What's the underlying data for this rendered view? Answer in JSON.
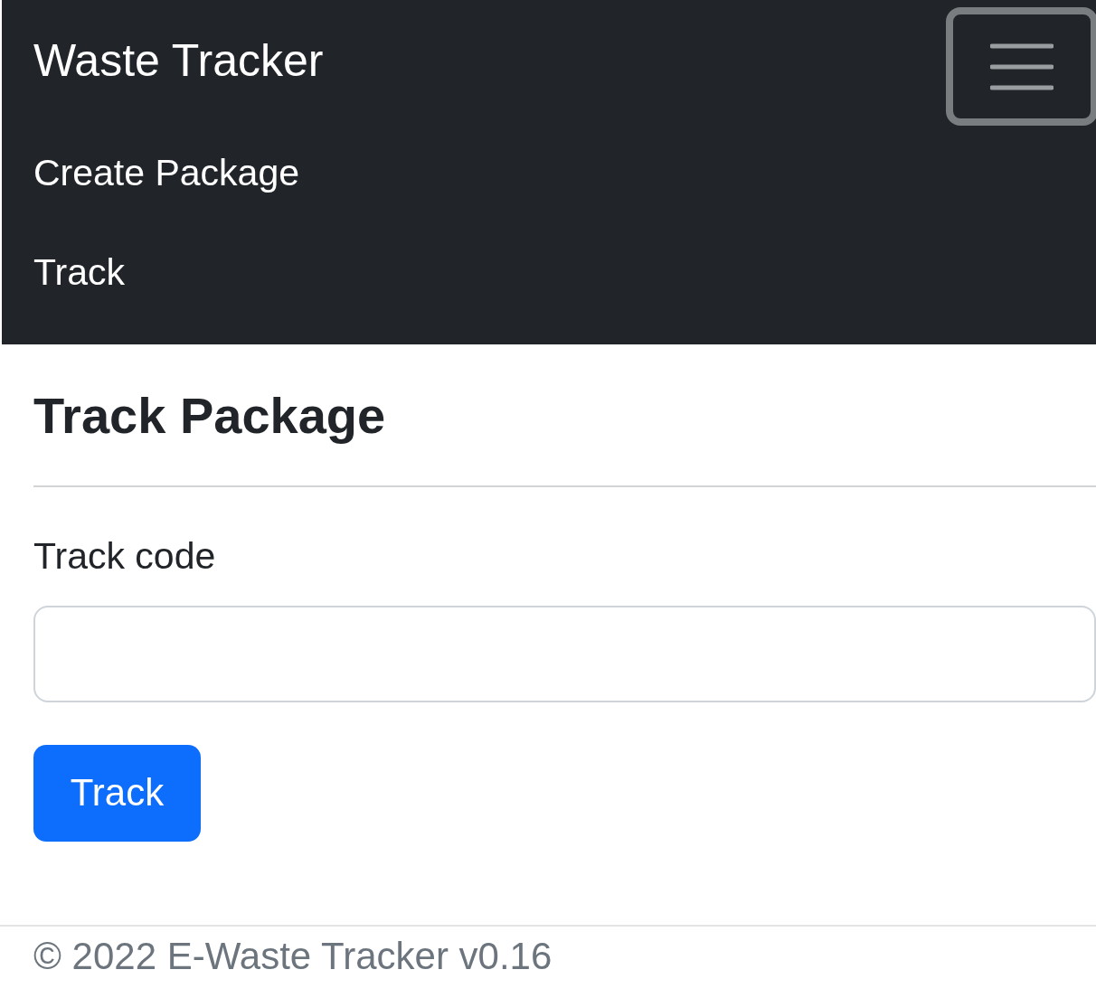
{
  "navbar": {
    "brand": "Waste Tracker",
    "expanded": true,
    "links": [
      {
        "label": "Create Package"
      },
      {
        "label": "Track"
      }
    ]
  },
  "page": {
    "title": "Track Package",
    "field_label": "Track code",
    "button": "Track"
  },
  "footer": {
    "text": "© 2022 E-Waste Tracker v0.16"
  }
}
